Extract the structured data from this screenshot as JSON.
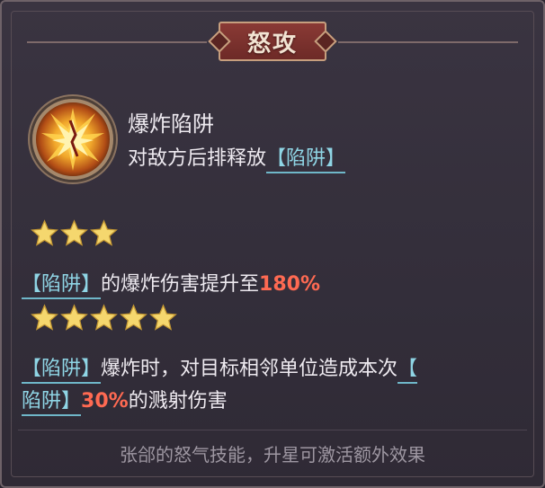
{
  "header": {
    "title": "怒攻"
  },
  "skill": {
    "icon": "explosion-trap-icon",
    "name": "爆炸陷阱",
    "desc_text": "对敌方后排释放",
    "desc_keyword": "【陷阱】"
  },
  "tiers": [
    {
      "stars": 3,
      "keyword": "【陷阱】",
      "text": "的爆炸伤害提升至",
      "value": "180%"
    },
    {
      "stars": 5,
      "keyword_1": "【陷阱】",
      "text_1": "爆炸时，对目标相邻单位造成本次",
      "keyword_2a": "【",
      "keyword_2b": "陷阱】",
      "value": "30%",
      "text_2": "的溅射伤害"
    }
  ],
  "footer": {
    "note": "张郃的怒气技能，升星可激活额外效果"
  },
  "colors": {
    "keyword": "#8fd5e5",
    "highlight": "#ff6a52",
    "star": "#f5d76e",
    "banner": "#7a322e"
  }
}
